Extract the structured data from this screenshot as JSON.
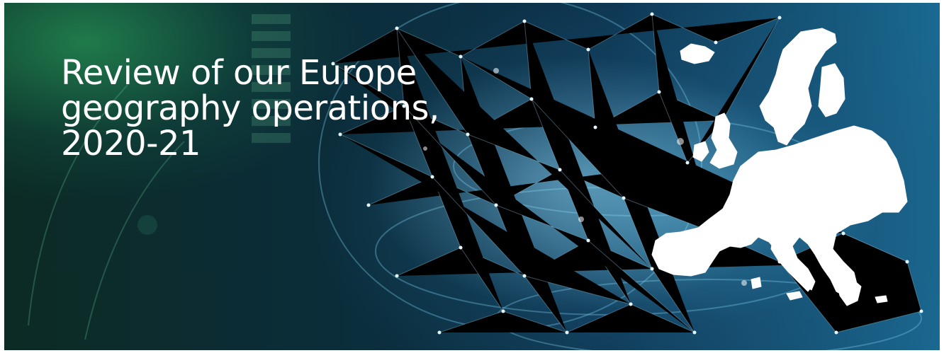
{
  "banner": {
    "title_lines": [
      "Review of our Europe",
      "geography operations,",
      "2020-21"
    ],
    "map_icon": "europe-map-icon",
    "colors": {
      "background_dark": "#0b2d3a",
      "accent_green": "#269656",
      "accent_blue": "#1a6a92",
      "map_fill": "#ffffff",
      "title_text": "#ffffff"
    }
  }
}
